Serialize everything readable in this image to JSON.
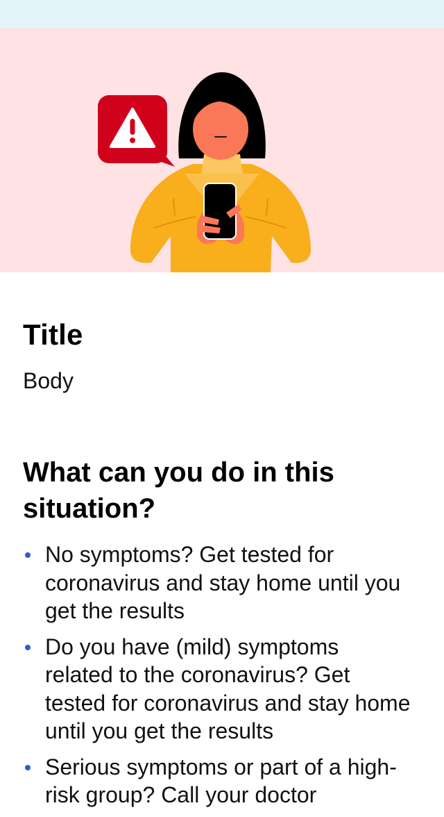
{
  "screen": {
    "status_bar_color": "#e2f6f9",
    "hero_background": "#ffe3e4"
  },
  "hero": {
    "illustration": "woman-looking-at-phone-with-warning-bubble",
    "warning_bubble_color": "#d0021b",
    "sweater_color": "#f9ae1b",
    "skin_color": "#fa7857",
    "icon": "warning-triangle-icon"
  },
  "content": {
    "title": "Title",
    "body": "Body",
    "section_heading": "What can you do in this situation?",
    "bullet_color": "#2d5bd6",
    "bullets": [
      "No symptoms? Get tested for coronavirus and stay home until you get the results",
      "Do you have (mild) symptoms related to the coronavirus? Get tested for coronavirus and stay home until you get the results",
      "Serious symptoms or part of a high-risk group? Call your doctor"
    ]
  }
}
